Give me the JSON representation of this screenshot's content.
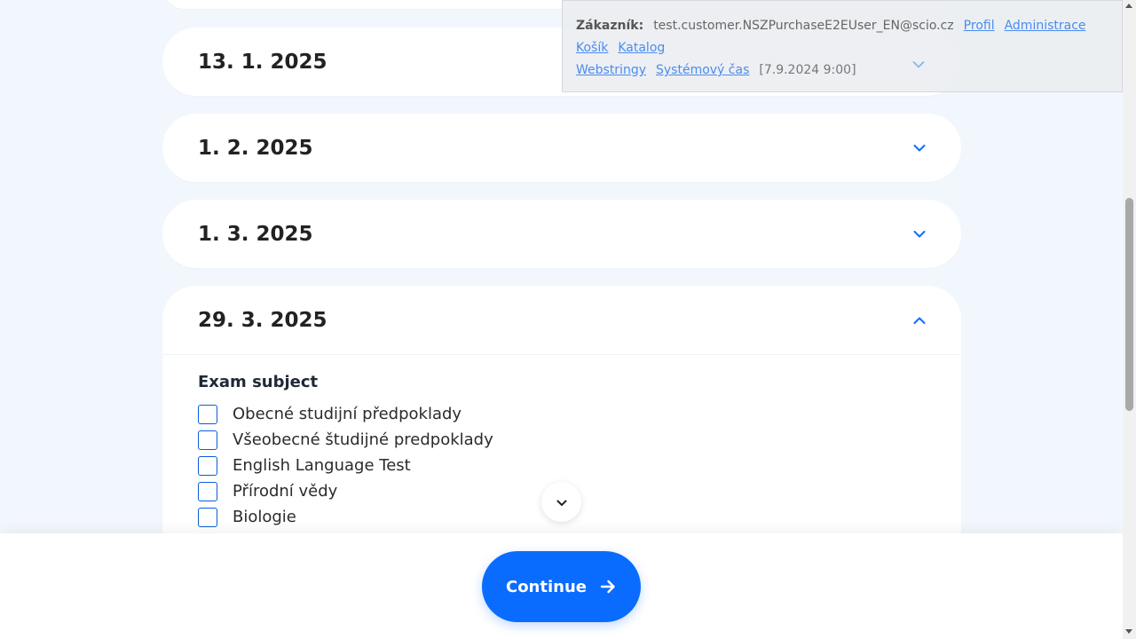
{
  "dates": [
    {
      "label": "13. 1. 2025",
      "expanded": false
    },
    {
      "label": "1. 2. 2025",
      "expanded": false
    },
    {
      "label": "1. 3. 2025",
      "expanded": false
    },
    {
      "label": "29. 3. 2025",
      "expanded": true
    }
  ],
  "exam": {
    "subject_label": "Exam subject",
    "subjects": [
      {
        "label": "Obecné studijní předpoklady",
        "checked": false
      },
      {
        "label": "Všeobecné študijné predpoklady",
        "checked": false
      },
      {
        "label": "English Language Test",
        "checked": false
      },
      {
        "label": "Přírodní vědy",
        "checked": false
      },
      {
        "label": "Biologie",
        "checked": false
      }
    ]
  },
  "footer": {
    "continue_label": "Continue"
  },
  "admin": {
    "customer_label": "Zákazník:",
    "customer_email": "test.customer.NSZPurchaseE2EUser_EN@scio.cz",
    "links": {
      "profil": "Profil",
      "administrace": "Administrace",
      "kosik": "Košík",
      "katalog": "Katalog",
      "webstringy": "Webstringy",
      "systemovy_cas": "Systémový čas"
    },
    "system_time": "[7.9.2024 9:00]"
  },
  "colors": {
    "accent": "#0a6cff",
    "checkbox_border": "#0a5ed7",
    "background": "#f2f7fd"
  },
  "icons": {
    "chevron": "chevron-down-icon",
    "arrow": "arrow-right-icon"
  }
}
